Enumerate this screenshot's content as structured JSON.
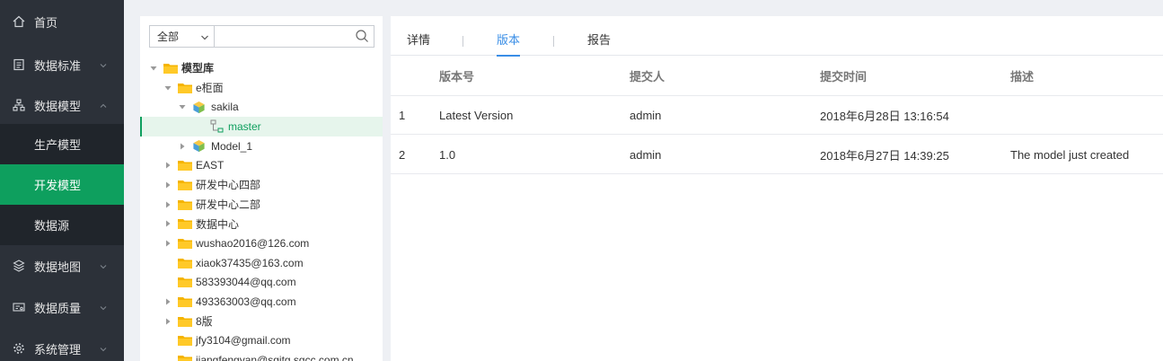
{
  "sidebar": {
    "items": [
      {
        "label": "首页",
        "icon": "home-icon"
      },
      {
        "label": "数据标准",
        "icon": "document-icon"
      },
      {
        "label": "数据模型",
        "icon": "org-chart-icon"
      },
      {
        "label": "数据地图",
        "icon": "map-icon"
      },
      {
        "label": "数据质量",
        "icon": "quality-icon"
      },
      {
        "label": "系统管理",
        "icon": "gear-icon"
      }
    ],
    "sub_items": [
      "生产模型",
      "开发模型",
      "数据源"
    ],
    "active_sub": "开发模型",
    "active_color": "#0e9f5e"
  },
  "tree_panel": {
    "filter_value": "全部",
    "search_value": "",
    "nodes": [
      {
        "label": "模型库",
        "type": "folder",
        "level": 0,
        "expanded": true
      },
      {
        "label": "e柜面",
        "type": "folder",
        "level": 1,
        "expanded": true
      },
      {
        "label": "sakila",
        "type": "model",
        "level": 2,
        "expanded": true
      },
      {
        "label": "master",
        "type": "branch",
        "level": 3,
        "selected": true
      },
      {
        "label": "Model_1",
        "type": "model",
        "level": 2,
        "expanded": false
      },
      {
        "label": "EAST",
        "type": "folder",
        "level": 1,
        "expanded": false
      },
      {
        "label": "研发中心四部",
        "type": "folder",
        "level": 1,
        "expanded": false
      },
      {
        "label": "研发中心二部",
        "type": "folder",
        "level": 1,
        "expanded": false
      },
      {
        "label": "数据中心",
        "type": "folder",
        "level": 1,
        "expanded": false
      },
      {
        "label": "wushao2016@126.com",
        "type": "folder",
        "level": 1,
        "expanded": false
      },
      {
        "label": "xiaok37435@163.com",
        "type": "folder",
        "level": 1,
        "leaf": true
      },
      {
        "label": "583393044@qq.com",
        "type": "folder",
        "level": 1,
        "leaf": true
      },
      {
        "label": "493363003@qq.com",
        "type": "folder",
        "level": 1,
        "expanded": false
      },
      {
        "label": "8版",
        "type": "folder",
        "level": 1,
        "expanded": false
      },
      {
        "label": "jfy3104@gmail.com",
        "type": "folder",
        "level": 1,
        "leaf": true
      },
      {
        "label": "jiangfengyan@sgitg.sgcc.com.cn",
        "type": "folder",
        "level": 1,
        "leaf": true
      }
    ]
  },
  "content": {
    "tabs": [
      "详情",
      "版本",
      "报告"
    ],
    "active_tab": "版本",
    "table": {
      "headers": [
        "",
        "版本号",
        "提交人",
        "提交时间",
        "描述"
      ],
      "rows": [
        [
          "1",
          "Latest Version",
          "admin",
          "2018年6月28日 13:16:54",
          ""
        ],
        [
          "2",
          "1.0",
          "admin",
          "2018年6月27日 14:39:25",
          "The model just created"
        ]
      ]
    }
  }
}
